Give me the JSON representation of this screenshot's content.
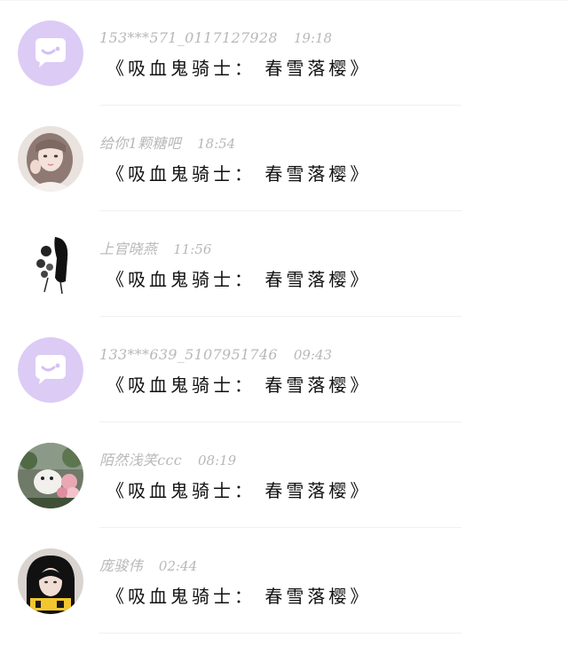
{
  "comments": [
    {
      "username": "153***571_0117127928",
      "time": "19:18",
      "message": "《吸血鬼骑士：  春雪落樱》",
      "avatar": "default-chat-bubble-avatar"
    },
    {
      "username": "给你1颗糖吧",
      "time": "18:54",
      "message": "《吸血鬼骑士：  春雪落樱》",
      "avatar": "girl-portrait-avatar"
    },
    {
      "username": "上官晓燕",
      "time": "11:56",
      "message": "《吸血鬼骑士：  春雪落樱》",
      "avatar": "ink-figure-avatar"
    },
    {
      "username": "133***639_5107951746",
      "time": "09:43",
      "message": "《吸血鬼骑士：  春雪落樱》",
      "avatar": "default-chat-bubble-avatar"
    },
    {
      "username": "陌然浅笑ccc",
      "time": "08:19",
      "message": "《吸血鬼骑士：  春雪落樱》",
      "avatar": "flowers-dog-avatar"
    },
    {
      "username": "庞骏伟",
      "time": "02:44",
      "message": "《吸血鬼骑士：  春雪落樱》",
      "avatar": "girl-black-hood-avatar"
    }
  ],
  "colors": {
    "default_avatar_bg": "#d9c8f4",
    "username": "#b8b8b8",
    "message": "#111111",
    "divider": "#f0f0f0"
  }
}
